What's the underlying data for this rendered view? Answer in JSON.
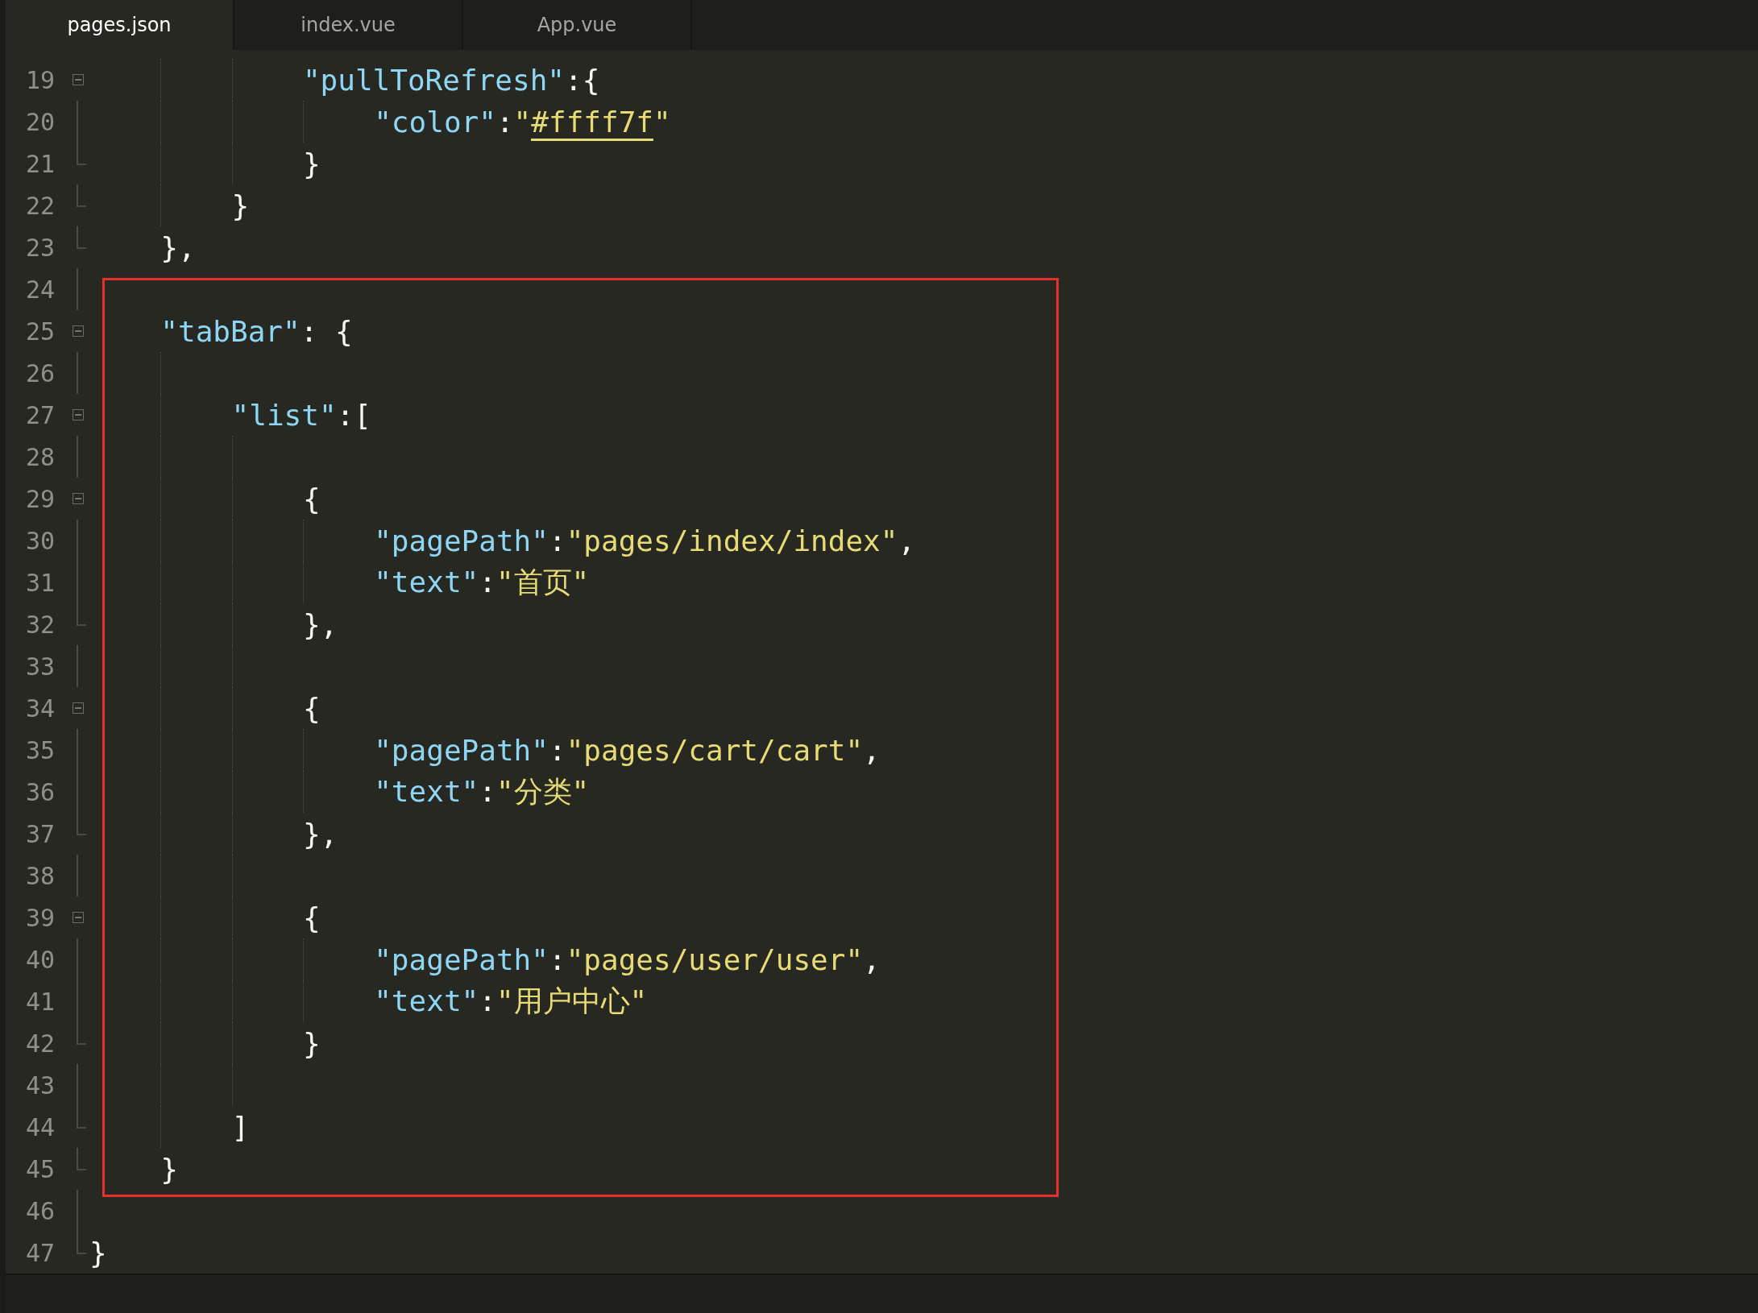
{
  "tabs": [
    {
      "label": "pages.json",
      "selected": true
    },
    {
      "label": "index.vue",
      "selected": false
    },
    {
      "label": "App.vue",
      "selected": false
    }
  ],
  "lines": [
    {
      "number": "19",
      "kind": "fold-start",
      "highlighted": false,
      "tokens": [
        {
          "kind": "key",
          "text": "\"pullToRefresh\""
        },
        {
          "kind": "punct",
          "text": ":{"
        }
      ]
    },
    {
      "number": "20",
      "kind": "plain",
      "highlighted": false,
      "tokens": [
        {
          "kind": "key",
          "text": "\"color\""
        },
        {
          "kind": "punct",
          "text": ":"
        },
        {
          "kind": "string",
          "text": "\""
        },
        {
          "kind": "color",
          "text": "#ffff7f"
        },
        {
          "kind": "string",
          "text": "\""
        }
      ]
    },
    {
      "number": "21",
      "kind": "fold-end",
      "highlighted": false,
      "tokens": [
        {
          "kind": "punct",
          "text": "}"
        }
      ]
    },
    {
      "number": "22",
      "kind": "fold-end",
      "highlighted": false,
      "tokens": [
        {
          "kind": "punct",
          "text": "}"
        }
      ]
    },
    {
      "number": "23",
      "kind": "fold-end",
      "highlighted": false,
      "tokens": [
        {
          "kind": "punct",
          "text": "},"
        }
      ]
    },
    {
      "number": "24",
      "kind": "plain",
      "highlighted": true
    },
    {
      "number": "25",
      "kind": "fold-start",
      "highlighted": true,
      "tokens": [
        {
          "kind": "key",
          "text": "\"tabBar\""
        },
        {
          "kind": "punct",
          "text": ": {"
        }
      ]
    },
    {
      "number": "26",
      "kind": "plain",
      "highlighted": true
    },
    {
      "number": "27",
      "kind": "fold-start",
      "highlighted": true,
      "tokens": [
        {
          "kind": "key",
          "text": "\"list\""
        },
        {
          "kind": "punct",
          "text": ":["
        }
      ]
    },
    {
      "number": "28",
      "kind": "plain",
      "highlighted": true
    },
    {
      "number": "29",
      "kind": "fold-start",
      "highlighted": true,
      "tokens": [
        {
          "kind": "punct",
          "text": "{"
        }
      ]
    },
    {
      "number": "30",
      "kind": "plain",
      "highlighted": true,
      "tokens": [
        {
          "kind": "key",
          "text": "\"pagePath\""
        },
        {
          "kind": "punct",
          "text": ":"
        },
        {
          "kind": "string",
          "text": "\"pages/index/index\""
        },
        {
          "kind": "punct",
          "text": ","
        }
      ]
    },
    {
      "number": "31",
      "kind": "plain",
      "highlighted": true,
      "tokens": [
        {
          "kind": "key",
          "text": "\"text\""
        },
        {
          "kind": "punct",
          "text": ":"
        },
        {
          "kind": "string",
          "text": "\"首页\""
        }
      ]
    },
    {
      "number": "32",
      "kind": "fold-end",
      "highlighted": true,
      "tokens": [
        {
          "kind": "punct",
          "text": "},"
        }
      ]
    },
    {
      "number": "33",
      "kind": "plain",
      "highlighted": true
    },
    {
      "number": "34",
      "kind": "fold-start",
      "highlighted": true,
      "tokens": [
        {
          "kind": "punct",
          "text": "{"
        }
      ]
    },
    {
      "number": "35",
      "kind": "plain",
      "highlighted": true,
      "tokens": [
        {
          "kind": "key",
          "text": "\"pagePath\""
        },
        {
          "kind": "punct",
          "text": ":"
        },
        {
          "kind": "string",
          "text": "\"pages/cart/cart\""
        },
        {
          "kind": "punct",
          "text": ","
        }
      ]
    },
    {
      "number": "36",
      "kind": "plain",
      "highlighted": true,
      "tokens": [
        {
          "kind": "key",
          "text": "\"text\""
        },
        {
          "kind": "punct",
          "text": ":"
        },
        {
          "kind": "string",
          "text": "\"分类\""
        }
      ]
    },
    {
      "number": "37",
      "kind": "fold-end",
      "highlighted": true,
      "tokens": [
        {
          "kind": "punct",
          "text": "},"
        }
      ]
    },
    {
      "number": "38",
      "kind": "plain",
      "highlighted": true
    },
    {
      "number": "39",
      "kind": "fold-start",
      "highlighted": true,
      "tokens": [
        {
          "kind": "punct",
          "text": "{"
        }
      ]
    },
    {
      "number": "40",
      "kind": "plain",
      "highlighted": true,
      "tokens": [
        {
          "kind": "key",
          "text": "\"pagePath\""
        },
        {
          "kind": "punct",
          "text": ":"
        },
        {
          "kind": "string",
          "text": "\"pages/user/user\""
        },
        {
          "kind": "punct",
          "text": ","
        }
      ]
    },
    {
      "number": "41",
      "kind": "plain",
      "highlighted": true,
      "tokens": [
        {
          "kind": "key",
          "text": "\"text\""
        },
        {
          "kind": "punct",
          "text": ":"
        },
        {
          "kind": "string",
          "text": "\"用户中心\""
        }
      ]
    },
    {
      "number": "42",
      "kind": "fold-end",
      "highlighted": true,
      "tokens": [
        {
          "kind": "punct",
          "text": "}"
        }
      ]
    },
    {
      "number": "43",
      "kind": "plain",
      "highlighted": true
    },
    {
      "number": "44",
      "kind": "fold-end",
      "highlighted": true,
      "tokens": [
        {
          "kind": "punct",
          "text": "]"
        }
      ]
    },
    {
      "number": "45",
      "kind": "fold-end",
      "highlighted": true,
      "tokens": [
        {
          "kind": "punct",
          "text": "}"
        }
      ]
    },
    {
      "number": "46",
      "kind": "plain",
      "highlighted": false
    },
    {
      "number": "47",
      "kind": "fold-end",
      "highlighted": false,
      "tokens": [
        {
          "kind": "punct",
          "text": "}"
        }
      ]
    }
  ]
}
